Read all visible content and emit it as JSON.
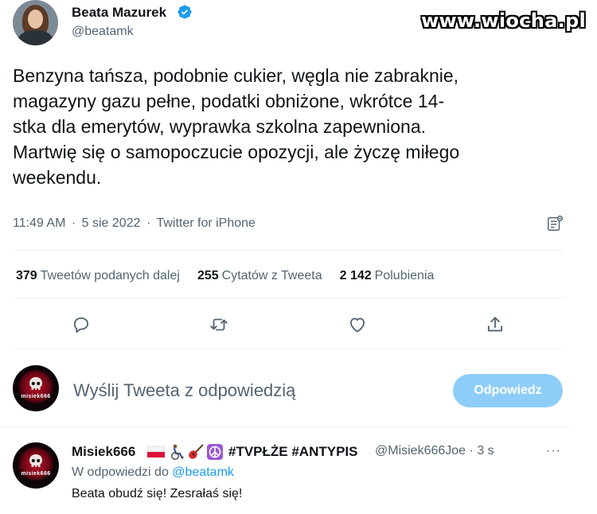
{
  "watermark": "www.wiocha.pl",
  "author": {
    "name": "Beata Mazurek",
    "handle": "@beatamk",
    "verified": true
  },
  "tweet": {
    "text_lines": [
      "Benzyna tańsza, podobnie cukier, węgla nie zabraknie,",
      "magazyny gazu pełne, podatki obniżone, wkrótce 14-",
      "stka dla emerytów, wyprawka szkolna zapewniona.",
      "Martwię się o samopoczucie opozycji, ale życzę miłego",
      "weekendu."
    ],
    "time": "11:49 AM",
    "separator": "·",
    "date": "5 sie 2022",
    "source": "Twitter for iPhone"
  },
  "stats": {
    "retweets_count": "379",
    "retweets_label": "Tweetów podanych dalej",
    "quotes_count": "255",
    "quotes_label": "Cytatów z Tweeta",
    "likes_count": "2 142",
    "likes_label": "Polubienia"
  },
  "actions": [
    "reply-icon",
    "retweet-icon",
    "like-icon",
    "share-icon"
  ],
  "compose": {
    "placeholder": "Wyślij Tweeta z odpowiedzią",
    "button_label": "Odpowiedz",
    "avatar_caption": "misiek666"
  },
  "reply": {
    "name": "Misiek666",
    "emojis": [
      "flag-poland",
      "wheelchair-person",
      "guitar",
      "peace-symbol"
    ],
    "tags": "#TVPŁŻE #ANTYPIS",
    "handle": "@Misiek666Joe",
    "separator": "·",
    "time": "3 s",
    "more": "···",
    "replying_prefix": "W odpowiedzi do",
    "replying_to": "@beatamk",
    "text": "Beata obudź się! Zesrałaś się!",
    "avatar_caption": "misiek666"
  },
  "colors": {
    "text_primary": "#0f1419",
    "text_secondary": "#536471",
    "accent": "#1d9bf0",
    "button_disabled": "#8ecdf8",
    "divider": "#eff3f4"
  }
}
